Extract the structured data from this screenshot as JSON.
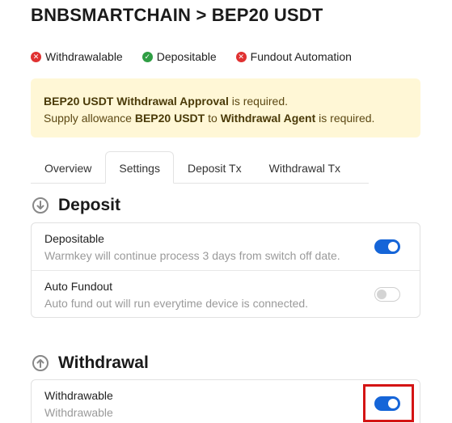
{
  "page": {
    "title": "BNBSMARTCHAIN > BEP20 USDT"
  },
  "status": [
    {
      "label": "Withdrawalable",
      "state": "no",
      "icon": "x-circle-icon"
    },
    {
      "label": "Depositable",
      "state": "yes",
      "icon": "check-circle-icon"
    },
    {
      "label": "Fundout Automation",
      "state": "no",
      "icon": "x-circle-icon"
    }
  ],
  "alert": {
    "line1_bold": "BEP20 USDT Withdrawal Approval",
    "line1_rest": " is required.",
    "line2_pre": "Supply allowance ",
    "line2_bold1": "BEP20 USDT",
    "line2_mid": " to ",
    "line2_bold2": "Withdrawal Agent",
    "line2_rest": " is required."
  },
  "tabs": [
    {
      "label": "Overview",
      "active": false
    },
    {
      "label": "Settings",
      "active": true
    },
    {
      "label": "Deposit Tx",
      "active": false
    },
    {
      "label": "Withdrawal Tx",
      "active": false
    }
  ],
  "deposit": {
    "title": "Deposit",
    "icon": "arrow-down-circle-icon",
    "rows": [
      {
        "title": "Depositable",
        "desc": "Warmkey will continue process 3 days from switch off date.",
        "enabled": true
      },
      {
        "title": "Auto Fundout",
        "desc": "Auto fund out will run everytime device is connected.",
        "enabled": false
      }
    ]
  },
  "withdrawal": {
    "title": "Withdrawal",
    "icon": "arrow-up-circle-icon",
    "rows": [
      {
        "title": "Withdrawable",
        "desc": "Withdrawable",
        "enabled": true
      }
    ]
  },
  "colors": {
    "toggle_on": "#1565d8",
    "alert_bg": "#fff7d6",
    "status_no": "#e03131",
    "status_yes": "#2f9e44",
    "highlight": "#d41414"
  }
}
